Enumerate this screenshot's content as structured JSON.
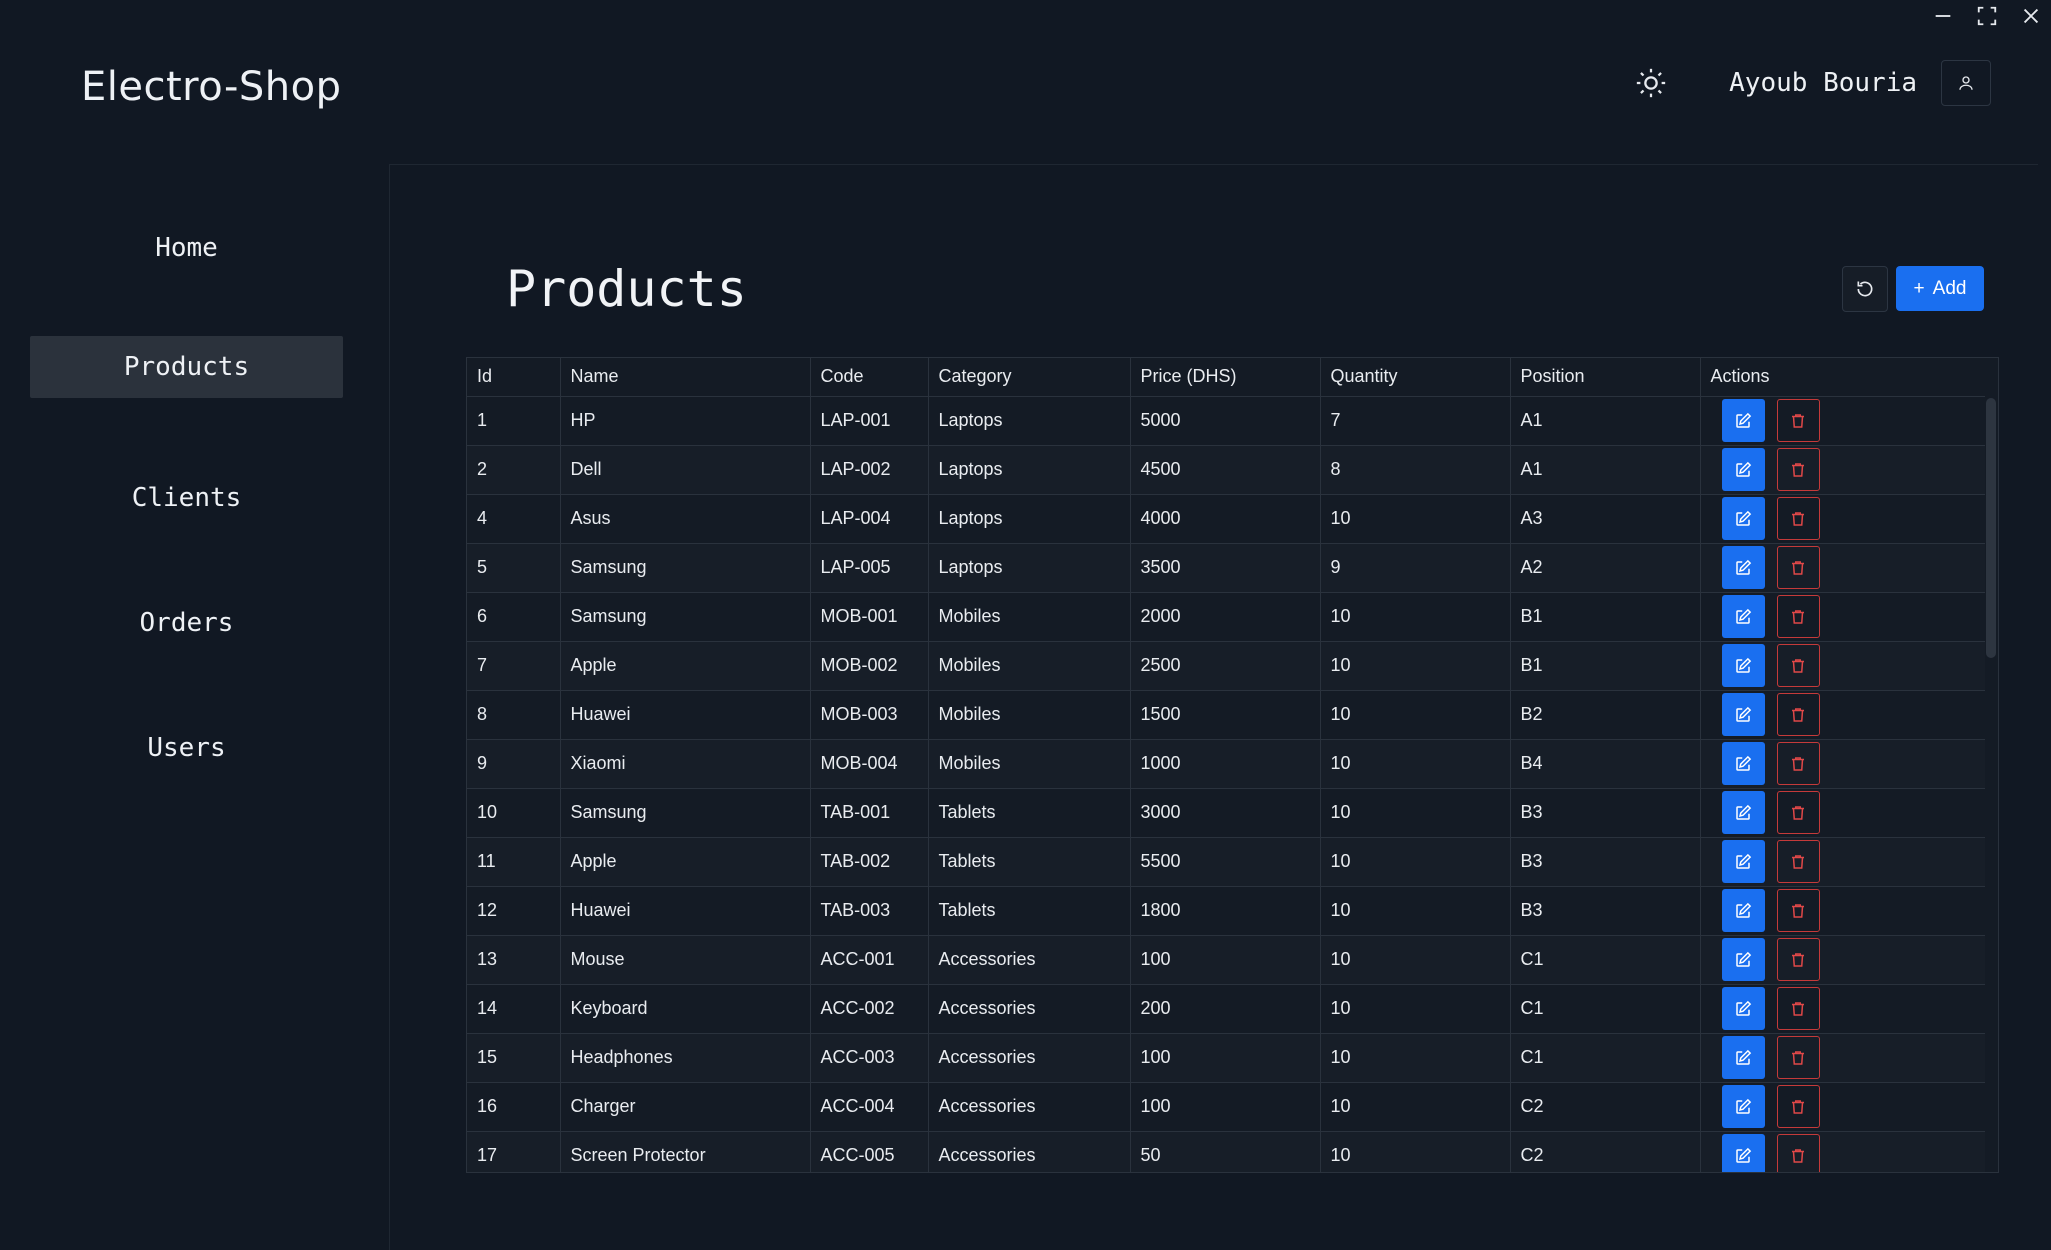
{
  "app": {
    "brand": "Electro-Shop"
  },
  "header": {
    "username": "Ayoub Bouria"
  },
  "sidebar": {
    "items": [
      {
        "label": "Home",
        "active": false
      },
      {
        "label": "Products",
        "active": true
      },
      {
        "label": "Clients",
        "active": false
      },
      {
        "label": "Orders",
        "active": false
      },
      {
        "label": "Users",
        "active": false
      }
    ]
  },
  "page": {
    "title": "Products",
    "add_label": "Add"
  },
  "table": {
    "headers": [
      "Id",
      "Name",
      "Code",
      "Category",
      "Price (DHS)",
      "Quantity",
      "Position",
      "Actions"
    ],
    "rows": [
      [
        "1",
        "HP",
        "LAP-001",
        "Laptops",
        "5000",
        "7",
        "A1"
      ],
      [
        "2",
        "Dell",
        "LAP-002",
        "Laptops",
        "4500",
        "8",
        "A1"
      ],
      [
        "4",
        "Asus",
        "LAP-004",
        "Laptops",
        "4000",
        "10",
        "A3"
      ],
      [
        "5",
        "Samsung",
        "LAP-005",
        "Laptops",
        "3500",
        "9",
        "A2"
      ],
      [
        "6",
        "Samsung",
        "MOB-001",
        "Mobiles",
        "2000",
        "10",
        "B1"
      ],
      [
        "7",
        "Apple",
        "MOB-002",
        "Mobiles",
        "2500",
        "10",
        "B1"
      ],
      [
        "8",
        "Huawei",
        "MOB-003",
        "Mobiles",
        "1500",
        "10",
        "B2"
      ],
      [
        "9",
        "Xiaomi",
        "MOB-004",
        "Mobiles",
        "1000",
        "10",
        "B4"
      ],
      [
        "10",
        "Samsung",
        "TAB-001",
        "Tablets",
        "3000",
        "10",
        "B3"
      ],
      [
        "11",
        "Apple",
        "TAB-002",
        "Tablets",
        "5500",
        "10",
        "B3"
      ],
      [
        "12",
        "Huawei",
        "TAB-003",
        "Tablets",
        "1800",
        "10",
        "B3"
      ],
      [
        "13",
        "Mouse",
        "ACC-001",
        "Accessories",
        "100",
        "10",
        "C1"
      ],
      [
        "14",
        "Keyboard",
        "ACC-002",
        "Accessories",
        "200",
        "10",
        "C1"
      ],
      [
        "15",
        "Headphones",
        "ACC-003",
        "Accessories",
        "100",
        "10",
        "C1"
      ],
      [
        "16",
        "Charger",
        "ACC-004",
        "Accessories",
        "100",
        "10",
        "C2"
      ],
      [
        "17",
        "Screen Protector",
        "ACC-005",
        "Accessories",
        "50",
        "10",
        "C2"
      ]
    ]
  },
  "colors": {
    "accent": "#1a6ff0",
    "danger": "#c53a3a",
    "background": "#111823"
  }
}
